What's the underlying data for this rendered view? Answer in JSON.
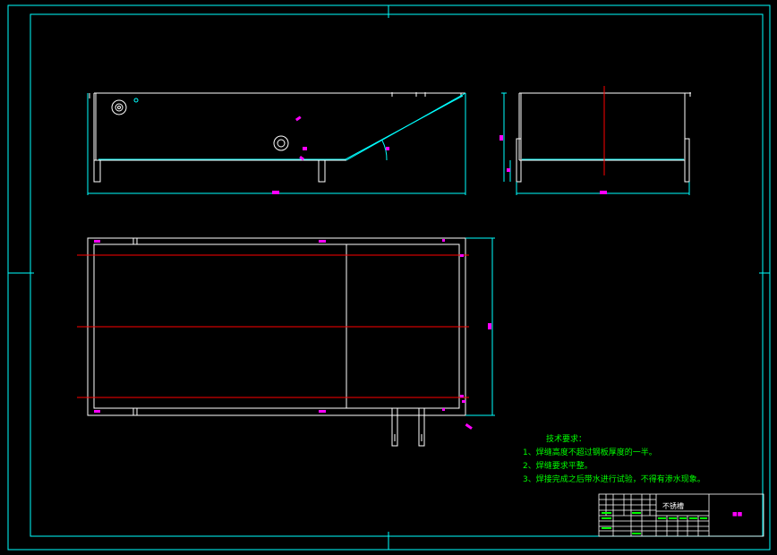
{
  "technical_requirements": {
    "title": "技术要求：",
    "items": [
      "1、焊缝高度不超过钢板厚度的一半。",
      "2、焊缝要求平整。",
      "3、焊接完成之后带水进行试验，不得有渗水现象。"
    ]
  },
  "title_block": {
    "part_name": "不锈槽"
  },
  "colors": {
    "background": "#000000",
    "border": "#00ffff",
    "outline": "#ffffff",
    "dimension": "#00ffff",
    "centerline": "#ff0000",
    "dimension_text": "#ff00ff",
    "notes": "#00ff00"
  }
}
